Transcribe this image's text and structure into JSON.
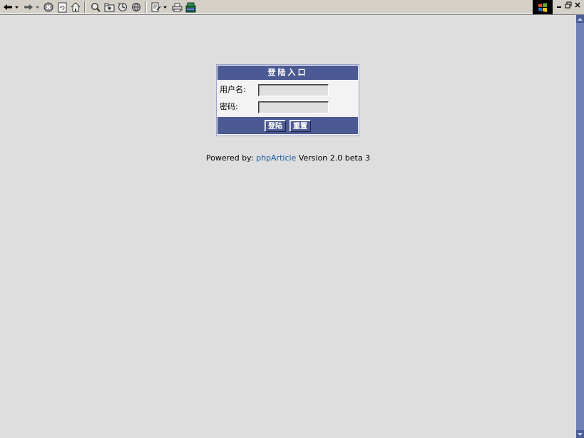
{
  "toolbar": {
    "icons": [
      "back-arrow-icon",
      "forward-arrow-icon",
      "stop-icon",
      "refresh-icon",
      "home-icon",
      "search-icon",
      "favorites-icon",
      "history-icon",
      "globe-icon",
      "edit-page-icon",
      "print-icon",
      "lite-icon"
    ]
  },
  "login": {
    "title": "登陆入口",
    "username_label": "用户名:",
    "username_value": "",
    "password_label": "密码:",
    "password_value": "",
    "submit_label": "登陆",
    "reset_label": "重置"
  },
  "credit": {
    "prefix": "Powered by: ",
    "link": "phpArticle",
    "suffix": " Version 2.0 beta 3"
  },
  "colors": {
    "page_background": "#dedede",
    "panel_header": "#4c5a93",
    "link": "#1a5a9e",
    "scrollbar": "#6f82b8"
  }
}
